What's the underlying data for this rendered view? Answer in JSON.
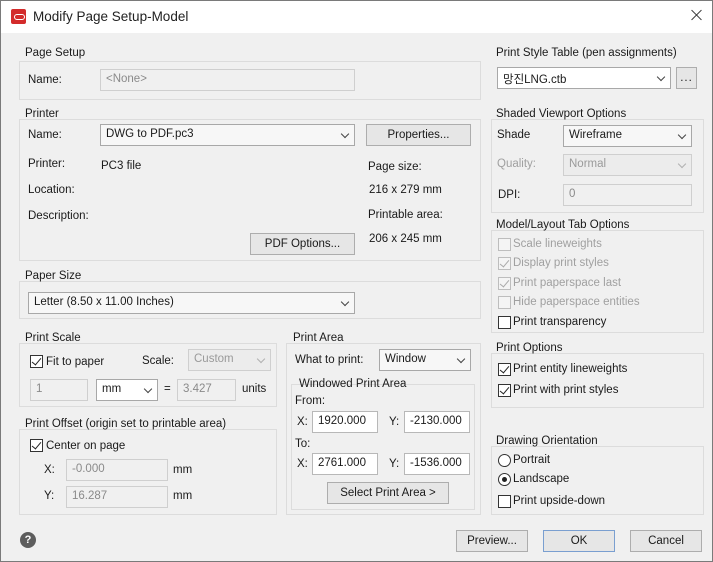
{
  "window": {
    "title": "Modify Page Setup-Model"
  },
  "page_setup": {
    "group_label": "Page Setup",
    "name_label": "Name:",
    "name_value": "<None>"
  },
  "printer": {
    "group_label": "Printer",
    "name_label": "Name:",
    "name_value": "DWG to PDF.pc3",
    "properties_button": "Properties...",
    "printer_label": "Printer:",
    "printer_value": "PC3 file",
    "location_label": "Location:",
    "description_label": "Description:",
    "page_size_label": "Page size:",
    "page_size_value": "216 x 279 mm",
    "printable_area_label": "Printable area:",
    "printable_area_value": "206 x 245 mm",
    "pdf_options_button": "PDF Options..."
  },
  "paper_size": {
    "group_label": "Paper Size",
    "value": "Letter (8.50 x 11.00 Inches)"
  },
  "print_scale": {
    "group_label": "Print Scale",
    "fit_to_paper_label": "Fit to paper",
    "fit_to_paper_checked": true,
    "scale_label": "Scale:",
    "scale_value": "Custom",
    "value_a": "1",
    "unit_value": "mm",
    "equals": "=",
    "value_b": "3.427",
    "units_label": "units"
  },
  "print_offset": {
    "group_label": "Print Offset (origin set to printable area)",
    "center_label": "Center on page",
    "center_checked": true,
    "x_label": "X:",
    "x_value": "-0.000",
    "x_unit": "mm",
    "y_label": "Y:",
    "y_value": "16.287",
    "y_unit": "mm"
  },
  "print_area": {
    "group_label": "Print Area",
    "what_label": "What to print:",
    "what_value": "Window",
    "windowed_label": "Windowed Print Area",
    "from_label": "From:",
    "from_x_label": "X:",
    "from_x": "1920.000",
    "from_y_label": "Y:",
    "from_y": "-2130.000",
    "to_label": "To:",
    "to_x_label": "X:",
    "to_x": "2761.000",
    "to_y_label": "Y:",
    "to_y": "-1536.000",
    "select_button": "Select Print Area >"
  },
  "print_style_table": {
    "group_label": "Print Style Table (pen assignments)",
    "value": "망진LNG.ctb",
    "more_button": "..."
  },
  "shaded_viewport": {
    "group_label": "Shaded Viewport Options",
    "shade_label": "Shade",
    "shade_value": "Wireframe",
    "quality_label": "Quality:",
    "quality_value": "Normal",
    "dpi_label": "DPI:",
    "dpi_value": "0"
  },
  "model_layout": {
    "group_label": "Model/Layout Tab Options",
    "items": [
      {
        "label": "Scale lineweights",
        "checked": false,
        "enabled": false
      },
      {
        "label": "Display print styles",
        "checked": true,
        "enabled": false
      },
      {
        "label": "Print paperspace last",
        "checked": true,
        "enabled": false
      },
      {
        "label": "Hide paperspace entities",
        "checked": false,
        "enabled": false
      },
      {
        "label": "Print transparency",
        "checked": false,
        "enabled": true
      }
    ]
  },
  "print_options": {
    "group_label": "Print Options",
    "items": [
      {
        "label": "Print entity lineweights",
        "checked": true
      },
      {
        "label": "Print with print styles",
        "checked": true
      }
    ]
  },
  "drawing_orientation": {
    "group_label": "Drawing Orientation",
    "portrait_label": "Portrait",
    "landscape_label": "Landscape",
    "selected": "Landscape",
    "upside_down_label": "Print upside-down",
    "upside_down_checked": false
  },
  "footer": {
    "help_icon": "?",
    "preview_button": "Preview...",
    "ok_button": "OK",
    "cancel_button": "Cancel"
  }
}
